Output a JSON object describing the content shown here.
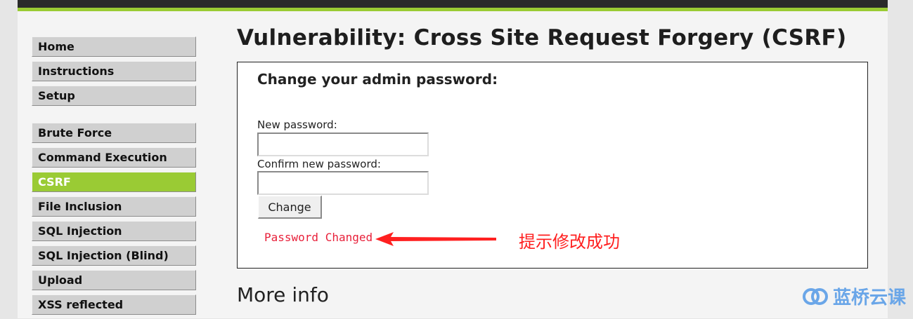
{
  "menu": {
    "groups": [
      [
        {
          "label": "Home"
        },
        {
          "label": "Instructions"
        },
        {
          "label": "Setup"
        }
      ],
      [
        {
          "label": "Brute Force"
        },
        {
          "label": "Command Execution"
        },
        {
          "label": "CSRF",
          "selected": true
        },
        {
          "label": "File Inclusion"
        },
        {
          "label": "SQL Injection"
        },
        {
          "label": "SQL Injection (Blind)"
        },
        {
          "label": "Upload"
        },
        {
          "label": "XSS reflected"
        }
      ]
    ]
  },
  "page": {
    "title": "Vulnerability: Cross Site Request Forgery (CSRF)",
    "form_heading": "Change your admin password:",
    "new_password_label": "New password:",
    "new_password_value": "",
    "confirm_password_label": "Confirm new password:",
    "confirm_password_value": "",
    "change_button": "Change",
    "status_message": "Password Changed",
    "annotation": "提示修改成功",
    "more_info_heading": "More info"
  },
  "watermark": {
    "text": "蓝桥云课"
  },
  "colors": {
    "accent_green": "#9acb34",
    "topbar": "#2a2a2a",
    "status_red": "#e8203a",
    "annotation_red": "#ff1f1f",
    "watermark_blue": "#6aa6e8"
  }
}
